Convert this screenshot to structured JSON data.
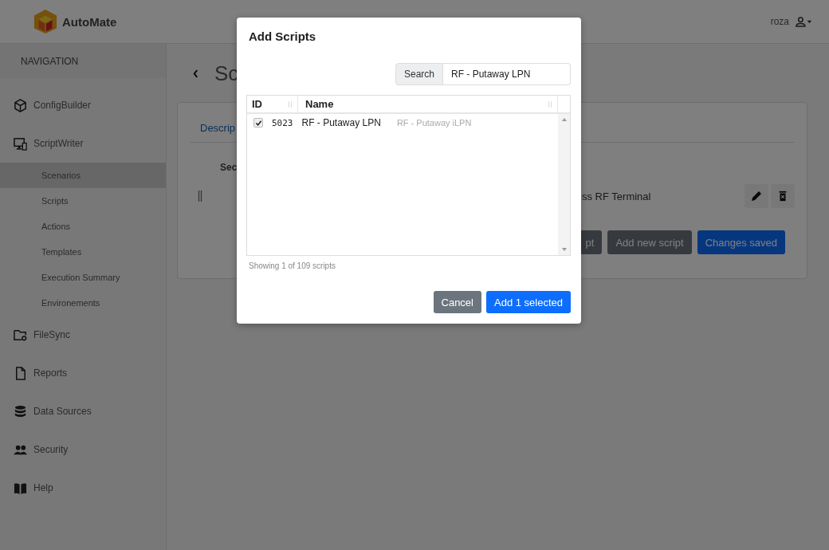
{
  "header": {
    "logo_text": "AutoMate",
    "user": "roza"
  },
  "sidebar": {
    "heading": "NAVIGATION",
    "items": [
      {
        "label": "ConfigBuilder"
      },
      {
        "label": "ScriptWriter",
        "children": [
          {
            "label": "Scenarios",
            "selected": true
          },
          {
            "label": "Scripts",
            "selected": false
          },
          {
            "label": "Actions",
            "selected": false
          },
          {
            "label": "Templates",
            "selected": false
          },
          {
            "label": "Execution Summary",
            "selected": false
          },
          {
            "label": "Environements",
            "selected": false
          }
        ]
      },
      {
        "label": "FileSync"
      },
      {
        "label": "Reports"
      },
      {
        "label": "Data Sources"
      },
      {
        "label": "Security"
      },
      {
        "label": "Help"
      }
    ]
  },
  "page": {
    "title": "Sc",
    "tab": "Descrip",
    "section": "Sec",
    "row_text": "ss RF Terminal",
    "buttons": [
      {
        "label": "pt",
        "kind": "secondary"
      },
      {
        "label": "Add new script",
        "kind": "secondary"
      },
      {
        "label": "Changes saved",
        "kind": "primary"
      }
    ]
  },
  "modal": {
    "title": "Add Scripts",
    "search": {
      "label": "Search",
      "value": "RF - Putaway LPN"
    },
    "table": {
      "columns": [
        "ID",
        "Name"
      ],
      "rows": [
        {
          "checked": true,
          "id": "5023",
          "name": "RF - Putaway LPN",
          "description": "RF - Putaway iLPN"
        }
      ]
    },
    "footer_note": "Showing 1 of 109 scripts",
    "buttons": [
      {
        "label": "Cancel",
        "kind": "secondary"
      },
      {
        "label": "Add 1 selected",
        "kind": "primary"
      }
    ]
  }
}
